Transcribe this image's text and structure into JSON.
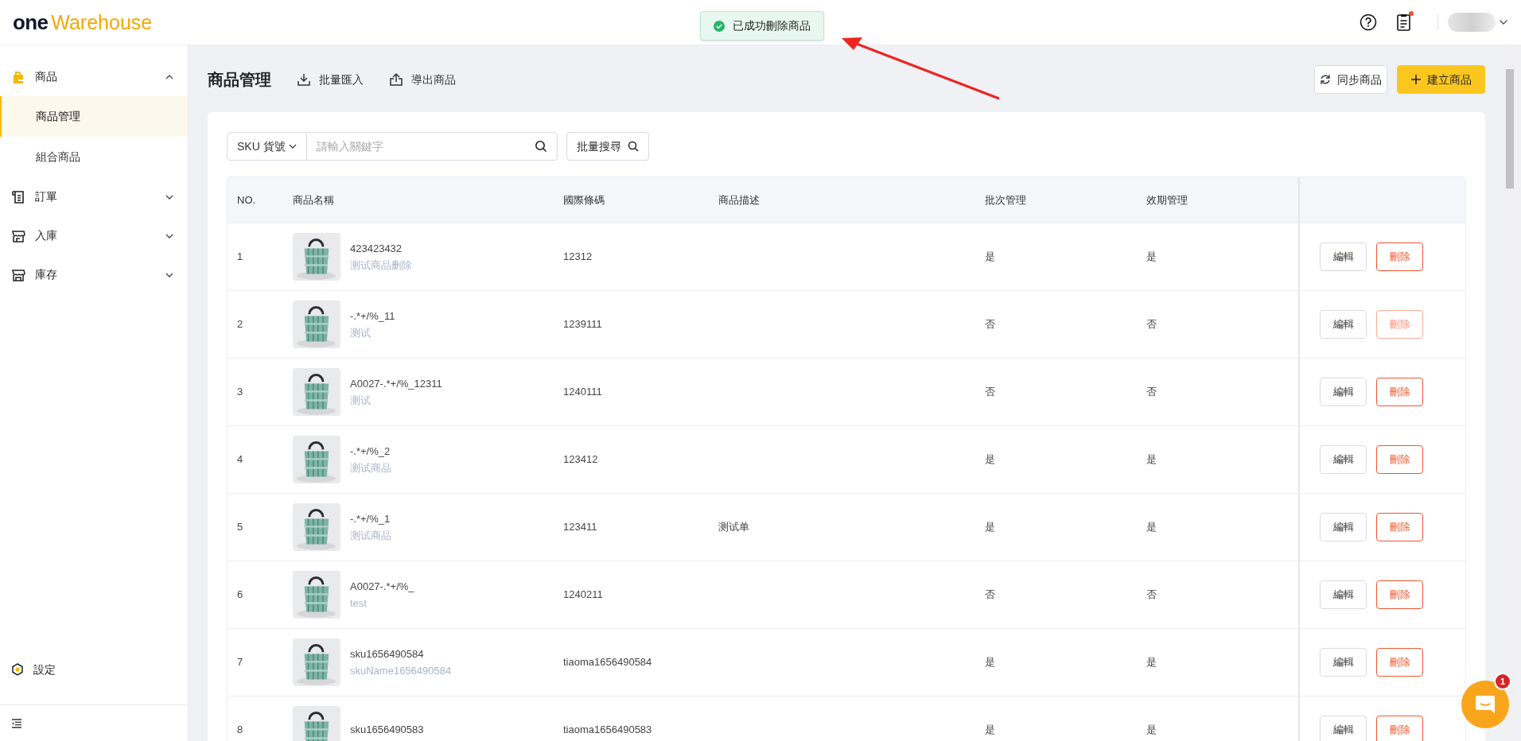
{
  "header": {
    "logo": {
      "mark": "one",
      "name": "Warehouse"
    },
    "notification_dot": true
  },
  "toast": {
    "kind": "success",
    "message": "已成功刪除商品"
  },
  "sidebar": {
    "items": [
      {
        "label": "商品",
        "kind": "bag",
        "expanded": true,
        "selected": false,
        "children": [
          {
            "label": "商品管理",
            "selected": true
          },
          {
            "label": "組合商品",
            "selected": false
          }
        ]
      },
      {
        "label": "訂單",
        "kind": "receipt",
        "expanded": false,
        "selected": false
      },
      {
        "label": "入庫",
        "kind": "store",
        "expanded": false,
        "selected": false
      },
      {
        "label": "庫存",
        "kind": "warehouse",
        "expanded": false,
        "selected": false
      }
    ],
    "settings": "設定"
  },
  "page": {
    "title": "商品管理",
    "links": [
      {
        "label": "批量匯入",
        "kind": "import"
      },
      {
        "label": "導出商品",
        "kind": "export"
      }
    ],
    "buttons": [
      {
        "label": "同步商品",
        "kind": "sync"
      },
      {
        "label": "建立商品",
        "kind": "create"
      }
    ]
  },
  "search": {
    "field_type": "SKU 貨號",
    "placeholder": "請輸入關鍵字",
    "bulk_button": "批量搜尋"
  },
  "table": {
    "columns": [
      "NO.",
      "商品名稱",
      "國際條碼",
      "商品描述",
      "批次管理",
      "效期管理"
    ],
    "rows": [
      {
        "no": "1",
        "sku": "423423432",
        "name": "测试商品删除",
        "barcode": "12312",
        "batch": "是",
        "expiry": "是",
        "actions": [
          {
            "kind": "edit",
            "label": "編輯"
          },
          {
            "kind": "delete",
            "label": "刪除",
            "faded": false
          }
        ]
      },
      {
        "no": "2",
        "sku": "-.*+/%_11",
        "name": "测试",
        "barcode": "1239111",
        "batch": "否",
        "expiry": "否",
        "actions": [
          {
            "kind": "edit",
            "label": "編輯"
          },
          {
            "kind": "delete",
            "label": "刪除",
            "faded": true
          }
        ]
      },
      {
        "no": "3",
        "sku": "A0027-.*+/%_12311",
        "name": "测试",
        "barcode": "1240111",
        "batch": "否",
        "expiry": "否",
        "actions": [
          {
            "kind": "edit",
            "label": "編輯"
          },
          {
            "kind": "delete",
            "label": "刪除",
            "faded": false
          }
        ]
      },
      {
        "no": "4",
        "sku": "-.*+/%_2",
        "name": "测试商品",
        "barcode": "123412",
        "batch": "是",
        "expiry": "是",
        "actions": [
          {
            "kind": "edit",
            "label": "編輯"
          },
          {
            "kind": "delete",
            "label": "刪除",
            "faded": false
          }
        ]
      },
      {
        "no": "5",
        "sku": "-.*+/%_1",
        "name": "测试商品",
        "barcode": "123411",
        "description": "测试单",
        "batch": "是",
        "expiry": "是",
        "actions": [
          {
            "kind": "edit",
            "label": "編輯"
          },
          {
            "kind": "delete",
            "label": "刪除",
            "faded": false
          }
        ]
      },
      {
        "no": "6",
        "sku": "A0027-.*+/%_",
        "name": "test",
        "barcode": "1240211",
        "batch": "否",
        "expiry": "否",
        "actions": [
          {
            "kind": "edit",
            "label": "編輯"
          },
          {
            "kind": "delete",
            "label": "刪除",
            "faded": false
          }
        ]
      },
      {
        "no": "7",
        "sku": "sku1656490584",
        "name": "skuName1656490584",
        "barcode": "tiaoma1656490584",
        "batch": "是",
        "expiry": "是",
        "actions": [
          {
            "kind": "edit",
            "label": "編輯"
          },
          {
            "kind": "delete",
            "label": "刪除",
            "faded": false
          }
        ]
      },
      {
        "no": "8",
        "sku": "sku1656490583",
        "barcode": "tiaoma1656490583",
        "batch": "是",
        "expiry": "是",
        "actions": [
          {
            "kind": "edit",
            "label": "編輯"
          },
          {
            "kind": "delete",
            "label": "刪除",
            "faded": false
          }
        ]
      }
    ]
  },
  "chat": {
    "badge": "1"
  }
}
